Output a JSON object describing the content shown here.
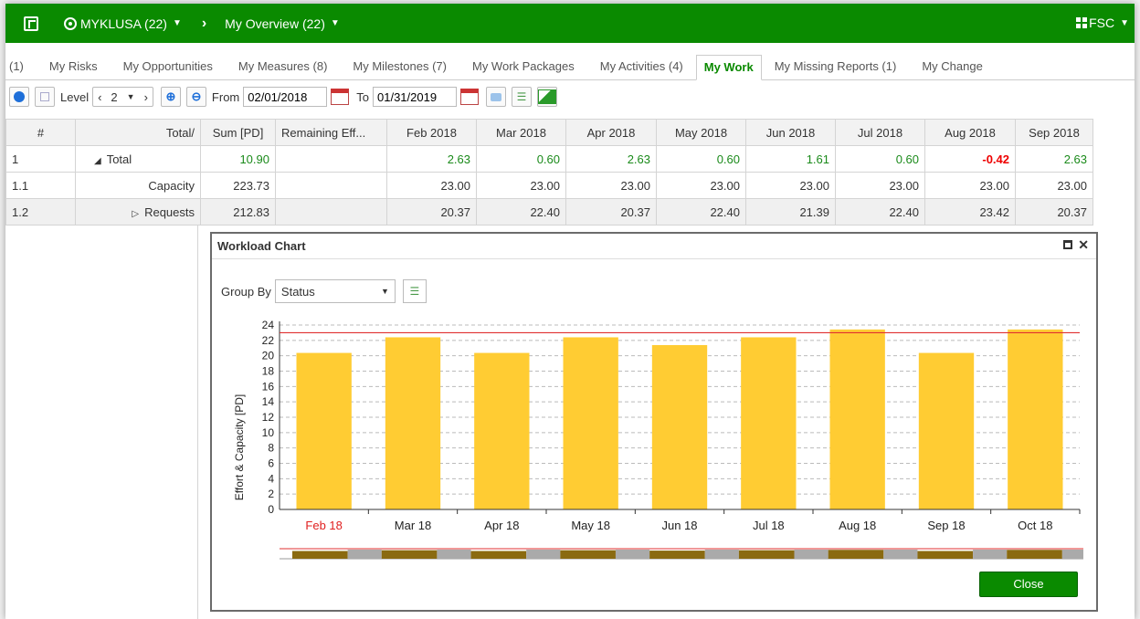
{
  "topbar": {
    "project": "MYKLUSA (22)",
    "view": "My Overview (22)",
    "user": "FSC"
  },
  "tabs": [
    {
      "label": "(1)"
    },
    {
      "label": "My Risks"
    },
    {
      "label": "My Opportunities"
    },
    {
      "label": "My Measures (8)"
    },
    {
      "label": "My Milestones (7)"
    },
    {
      "label": "My Work Packages"
    },
    {
      "label": "My Activities (4)"
    },
    {
      "label": "My Work",
      "active": true
    },
    {
      "label": "My Missing Reports (1)"
    },
    {
      "label": "My Change"
    }
  ],
  "toolbar": {
    "level_label": "Level",
    "level_value": "2",
    "from_label": "From",
    "from_date": "02/01/2018",
    "to_label": "To",
    "to_date": "01/31/2019"
  },
  "table": {
    "headers": [
      "#",
      "Total/",
      "Sum [PD]",
      "Remaining Eff...",
      "Feb 2018",
      "Mar 2018",
      "Apr 2018",
      "May 2018",
      "Jun 2018",
      "Jul 2018",
      "Aug 2018",
      "Sep 2018"
    ],
    "rows": [
      {
        "num": "1",
        "name": "Total",
        "sum": "10.90",
        "values": [
          "2.63",
          "0.60",
          "2.63",
          "0.60",
          "1.61",
          "0.60",
          "-0.42",
          "2.63"
        ]
      },
      {
        "num": "1.1",
        "name": "Capacity",
        "sum": "223.73",
        "values": [
          "23.00",
          "23.00",
          "23.00",
          "23.00",
          "23.00",
          "23.00",
          "23.00",
          "23.00"
        ]
      },
      {
        "num": "1.2",
        "name": "Requests",
        "sum": "212.83",
        "values": [
          "20.37",
          "22.40",
          "20.37",
          "22.40",
          "21.39",
          "22.40",
          "23.42",
          "20.37"
        ]
      }
    ]
  },
  "dialog": {
    "title": "Workload Chart",
    "group_by_label": "Group By",
    "group_by_value": "Status",
    "close_label": "Close"
  },
  "chart_data": {
    "type": "bar",
    "categories": [
      "Feb 18",
      "Mar 18",
      "Apr 18",
      "May 18",
      "Jun 18",
      "Jul 18",
      "Aug 18",
      "Sep 18",
      "Oct 18"
    ],
    "values": [
      20.37,
      22.4,
      20.37,
      22.4,
      21.39,
      22.4,
      23.42,
      20.37,
      23.42
    ],
    "capacity": 23.0,
    "ylabel": "Effort & Capacity [PD]",
    "ylim": [
      0,
      24
    ],
    "yticks": [
      0,
      2,
      4,
      6,
      8,
      10,
      12,
      14,
      16,
      18,
      20,
      22,
      24
    ],
    "grid": true,
    "bar_color": "#ffcc33",
    "capacity_color": "#e03030",
    "highlight_category_color": "#e02020"
  },
  "colors": {
    "brand": "#0a8a00",
    "positive": "#1a8a1a",
    "negative": "#e00000"
  }
}
